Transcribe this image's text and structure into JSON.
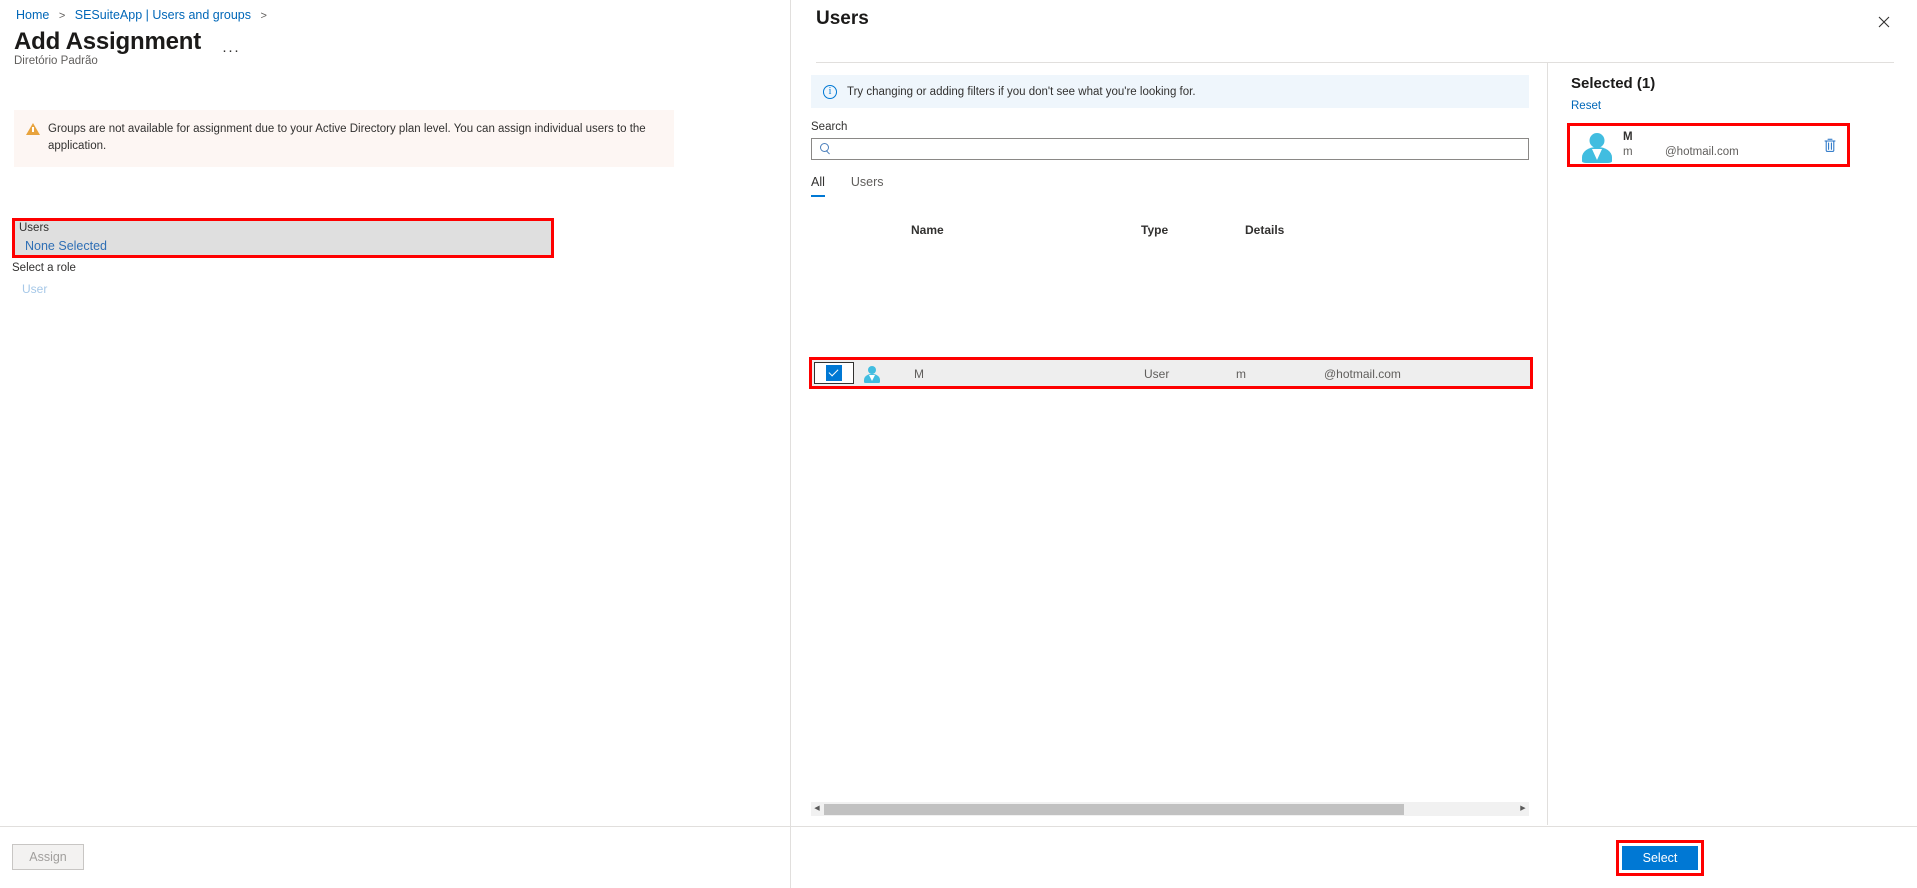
{
  "breadcrumb": {
    "items": [
      {
        "label": "Home"
      },
      {
        "label": "SESuiteApp | Users and groups"
      }
    ],
    "separator": ">"
  },
  "left_pane": {
    "title": "Add Assignment",
    "ellipsis": "···",
    "subtitle": "Diretório Padrão",
    "warning": {
      "icon": "warning-triangle-icon",
      "text": "Groups are not available for assignment due to your Active Directory plan level. You can assign individual users to the application."
    },
    "users_field": {
      "label": "Users",
      "value": "None Selected"
    },
    "role": {
      "label": "Select a role",
      "value": "User"
    },
    "assign_button": "Assign"
  },
  "blade": {
    "title": "Users",
    "close_icon": "close-icon",
    "info_banner": {
      "icon": "info-circle-icon",
      "text": "Try changing or adding filters if you don't see what you're looking for."
    },
    "search": {
      "label": "Search",
      "value": "",
      "placeholder": "",
      "icon": "search-icon"
    },
    "tabs": [
      {
        "label": "All",
        "active": true
      },
      {
        "label": "Users",
        "active": false
      }
    ],
    "table": {
      "columns": [
        "Name",
        "Type",
        "Details"
      ],
      "rows": [
        {
          "checked": true,
          "avatar": "person-icon",
          "name": "M",
          "type": "User",
          "detail_user": "m",
          "detail_domain": "@hotmail.com"
        }
      ]
    },
    "scrollbar": {
      "left_arrow": "◀",
      "right_arrow": "▶"
    },
    "selected_panel": {
      "title": "Selected (1)",
      "reset_label": "Reset",
      "items": [
        {
          "avatar": "person-icon",
          "name": "M",
          "sub": "m",
          "domain": "@hotmail.com",
          "delete_icon": "trash-icon"
        }
      ]
    },
    "select_button": "Select"
  },
  "colors": {
    "accent": "#0078d4",
    "link": "#0067b8",
    "highlight_box": "#fe0000",
    "warning_bg": "#fdf6f3",
    "info_bg": "#eff6fc",
    "row_bg": "#eeeeee",
    "field_bg": "#dfdfdf"
  }
}
